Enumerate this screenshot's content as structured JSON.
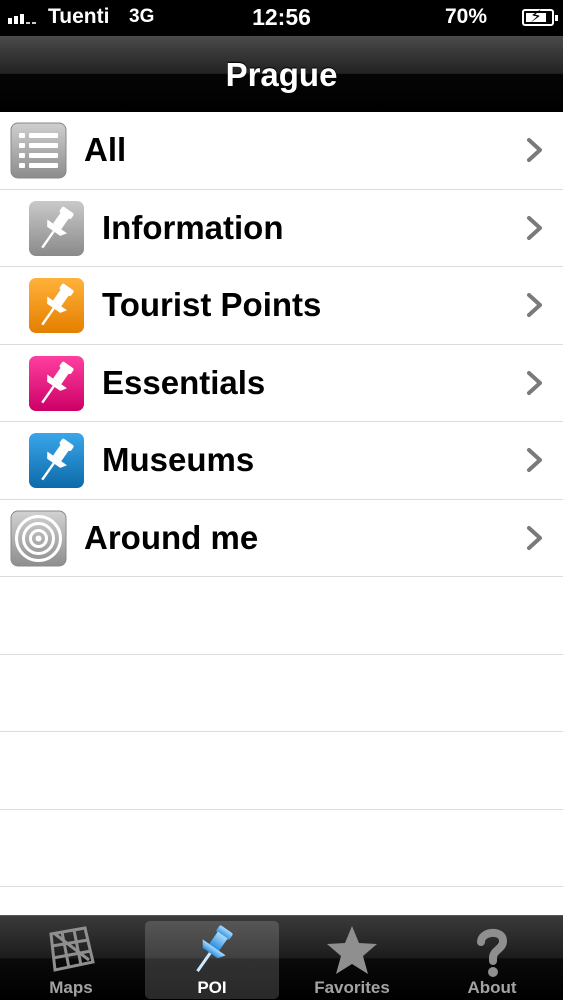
{
  "status_bar": {
    "carrier": "Tuenti",
    "network": "3G",
    "time": "12:56",
    "battery": "70%"
  },
  "nav": {
    "title": "Prague"
  },
  "menu": {
    "all": "All",
    "information": "Information",
    "tourist_points": "Tourist Points",
    "essentials": "Essentials",
    "museums": "Museums",
    "around_me": "Around me"
  },
  "category_colors": {
    "information": "#9a9a9a",
    "tourist_points": "#f39a10",
    "essentials": "#e6147a",
    "museums": "#1f86c8"
  },
  "tabs": {
    "maps": "Maps",
    "poi": "POI",
    "favorites": "Favorites",
    "about": "About",
    "selected": "POI"
  },
  "icons": {
    "all": "list-icon",
    "category": "pushpin-icon",
    "around_me": "radar-icon",
    "maps": "map-grid-icon",
    "poi": "pushpin-icon",
    "favorites": "star-icon",
    "about": "question-mark-icon"
  }
}
